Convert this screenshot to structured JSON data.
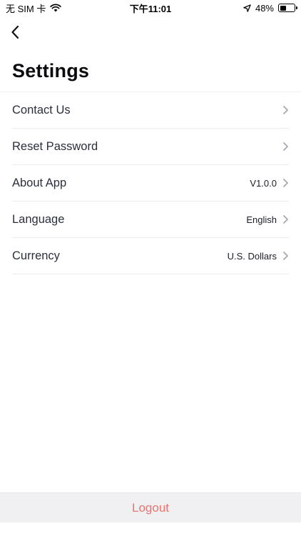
{
  "status_bar": {
    "carrier": "无 SIM 卡",
    "time": "下午11:01",
    "battery_percent_text": "48%",
    "battery_level": 0.48
  },
  "nav": {
    "back_icon": "chevron-left-icon"
  },
  "page": {
    "title": "Settings"
  },
  "settings": {
    "items": [
      {
        "label": "Contact Us",
        "value": ""
      },
      {
        "label": "Reset Password",
        "value": ""
      },
      {
        "label": "About App",
        "value": "V1.0.0"
      },
      {
        "label": "Language",
        "value": "English"
      },
      {
        "label": "Currency",
        "value": "U.S. Dollars"
      }
    ]
  },
  "footer": {
    "logout_label": "Logout"
  },
  "colors": {
    "logout_text": "#e8746f",
    "logout_bg": "#f0f0f2",
    "divider": "#ececef",
    "chevron": "#a7a9b0"
  }
}
